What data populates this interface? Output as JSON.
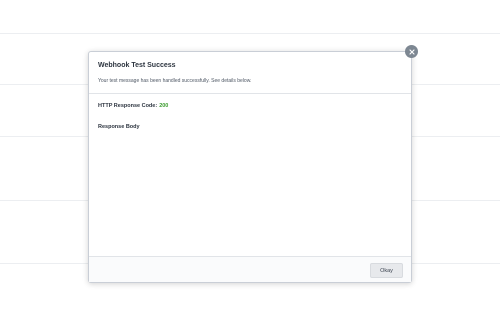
{
  "dialog": {
    "title": "Webhook Test Success",
    "subtitle": "Your test message has been handled successfully. See details below.",
    "close_icon": "close-icon",
    "response_code_label": "HTTP Response Code:",
    "response_code_value": "200",
    "response_code_color": "#3a9b2e",
    "response_body_label": "Response Body",
    "okay_label": "Okay"
  }
}
